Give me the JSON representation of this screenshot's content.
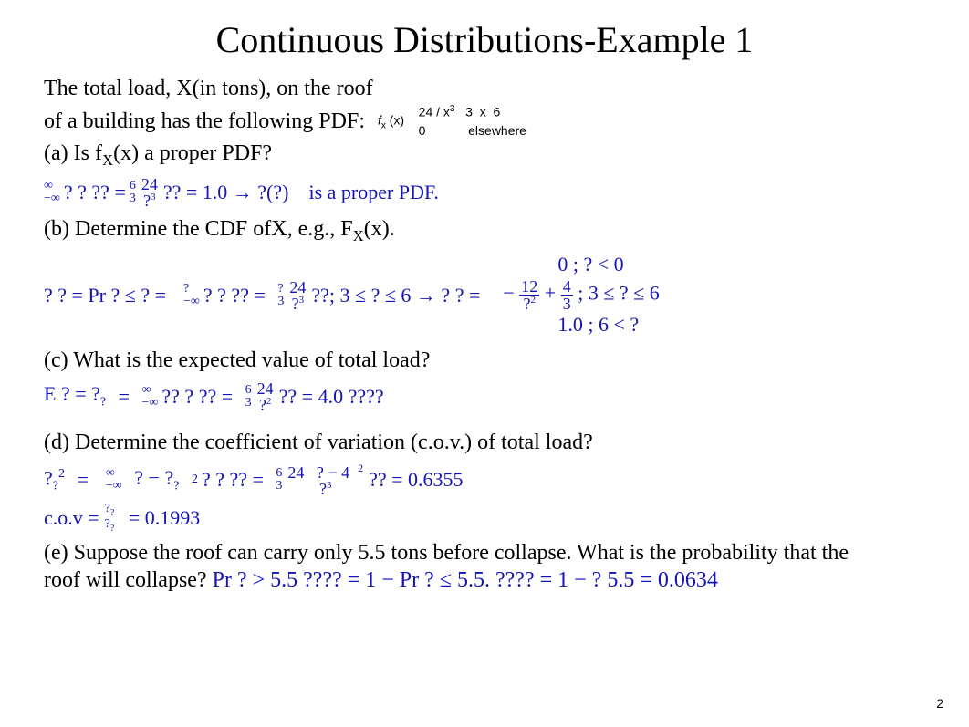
{
  "title": "Continuous Distributions-Example 1",
  "intro": {
    "line1_a": "The total load, ",
    "line1_b": "X",
    "line1_c": "(in tons), on the roof",
    "line2": "of a building has the following PDF:",
    "pdf_func": "f",
    "pdf_sub": "x",
    "pdf_arg": "(x)",
    "pdf_case1_a": "24 / x",
    "pdf_case1_exp": "3",
    "pdf_case1_b": "3",
    "pdf_case1_c": "x",
    "pdf_case1_d": "6",
    "pdf_case2_a": "0",
    "pdf_case2_b": "elsewhere"
  },
  "partA": {
    "q": "(a) Is f",
    "q_sub": "X",
    "q2": "(x) a proper PDF?",
    "lim_top1": "∞",
    "lim_bot1": "−∞",
    "seg1": "?  ?  ??  =",
    "lim_top2": "6",
    "lim_bot2": "3",
    "frac_top": "24",
    "frac_bot": "?",
    "frac_exp": "3",
    "seg2": "?? = 1.0 → ?(?)",
    "seg3": "is a proper PDF."
  },
  "partB": {
    "q1": "(b) Determine the CDF of",
    "q_var": "X",
    "q2": ", e.g., F",
    "q_sub": "X",
    "q3": "(x).",
    "seg1": "?  ?   = Pr   ? ≤ ?    =",
    "lim_top1": "?",
    "lim_bot1": "−∞",
    "seg2": "?  ?  ??  =",
    "lim_top2": "?",
    "lim_bot2": "3",
    "frac_top": "24",
    "frac_bot": "?",
    "frac_exp": "3",
    "seg3": "??; 3 ≤ ? ≤ 6 → ?    ?   =",
    "case1": "0 ; ? < 0",
    "case2_a": "−",
    "case2_frac1_top": "12",
    "case2_frac1_bot": "?",
    "case2_frac1_exp": "2",
    "case2_b": "+",
    "case2_frac2_top": "4",
    "case2_frac2_bot": "3",
    "case2_c": "; 3 ≤ ? ≤ 6",
    "case3": "1.0 ; 6 < ?"
  },
  "partC": {
    "q": "(c) What is the expected value of total load?",
    "seg1": "E ?  =  ?",
    "sub1": "?",
    "seg2": "=",
    "lim_top1": "∞",
    "lim_bot1": "−∞",
    "seg3": "??   ?  ??  =",
    "lim_top2": "6",
    "lim_bot2": "3",
    "frac_top": "24",
    "frac_bot": "?",
    "frac_exp": "2",
    "seg4": "?? = 4.0 ????"
  },
  "partD": {
    "q": "(d) Determine the coefficient of variation (c.o.v.) of total load?",
    "var_sym": "?",
    "var_sub": "?",
    "var_exp": "2",
    "seg1": "=",
    "lim_top1": "∞",
    "lim_bot1": "−∞",
    "seg2": "? − ?",
    "sub2": "?",
    "exp2": "2",
    "seg3": "?  ?  ??  =",
    "lim_top2": "6",
    "lim_bot2": "3",
    "frac_top": "24",
    "paren_a": "? − 4",
    "paren_exp": "2",
    "frac_bot": "?",
    "frac_exp": "3",
    "seg4": "?? = 0.6355",
    "cov_label": "c.o.v =",
    "cov_frac_top": "?",
    "cov_frac_top_sub": "?",
    "cov_frac_bot": "?",
    "cov_frac_bot_sub": "?",
    "cov_val": "= 0.1993"
  },
  "partE": {
    "q1": "(e) Suppose the roof can carry only 5.5 tons before collapse. What is the probability that the",
    "q2": "roof will collapse?",
    "ans": "Pr  ? > 5.5 ????     = 1 − Pr    ? ≤ 5.5. ????     = 1 − ?    5.5   = 0.0634"
  },
  "pageNum": "2"
}
